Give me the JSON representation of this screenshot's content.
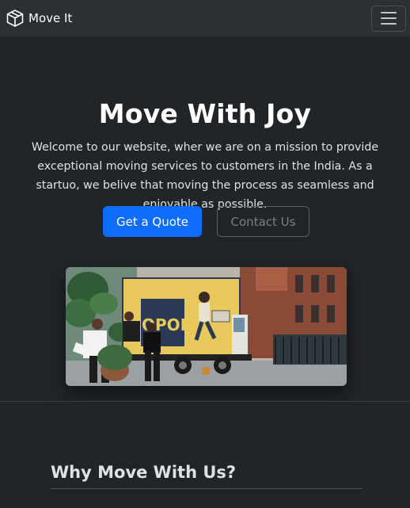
{
  "navbar": {
    "brand": "Move It",
    "brand_icon": "box-icon",
    "toggler_icon": "hamburger-icon"
  },
  "hero": {
    "title": "Move With Joy",
    "description": "Welcome to our website, wher we are on a mission to provide exceptional moving services to customers in the India. As a startuo, we belive that moving the process as seamless and enjoyable as possible.",
    "primary_button": "Get a Quote",
    "secondary_button": "Contact Us",
    "image_truck_text": "OPOLIS"
  },
  "section": {
    "title": "Why Move With Us?"
  },
  "colors": {
    "background": "#212529",
    "navbar": "#2b3035",
    "primary": "#0d6efd",
    "text": "#dee2e6",
    "heading": "#ffffff"
  }
}
